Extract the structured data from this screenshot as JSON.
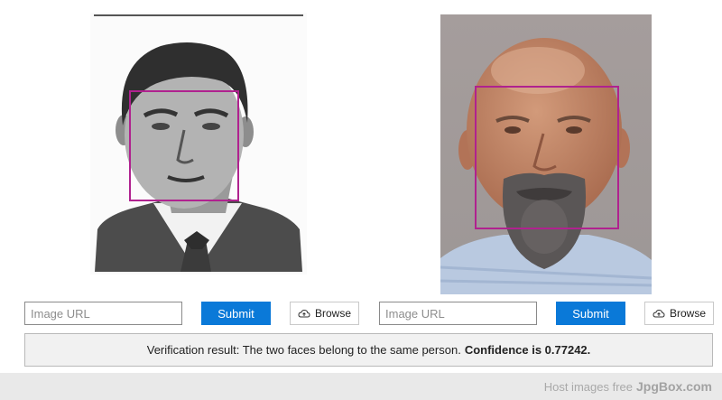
{
  "left_panel": {
    "photo_alt": "Grayscale scanned ID photo of a man in a suit and tie",
    "input_placeholder": "Image URL",
    "submit_label": "Submit",
    "browse_label": "Browse",
    "browse_icon": "cloud-upload-icon"
  },
  "right_panel": {
    "photo_alt": "Color photo of a bald man with a grey beard",
    "input_placeholder": "Image URL",
    "submit_label": "Submit",
    "browse_label": "Browse",
    "browse_icon": "cloud-upload-icon"
  },
  "result": {
    "prefix": "Verification result: The two faces belong to the same person.",
    "confidence_text": "Confidence is 0.77242."
  },
  "footer": {
    "text": "Host images free",
    "brand": "JpgBox.com"
  },
  "colors": {
    "face_box": "#b0228f",
    "submit_bg": "#0a79d8",
    "result_bg": "#f1f1f1",
    "footer_bg": "#e9e9e9"
  }
}
